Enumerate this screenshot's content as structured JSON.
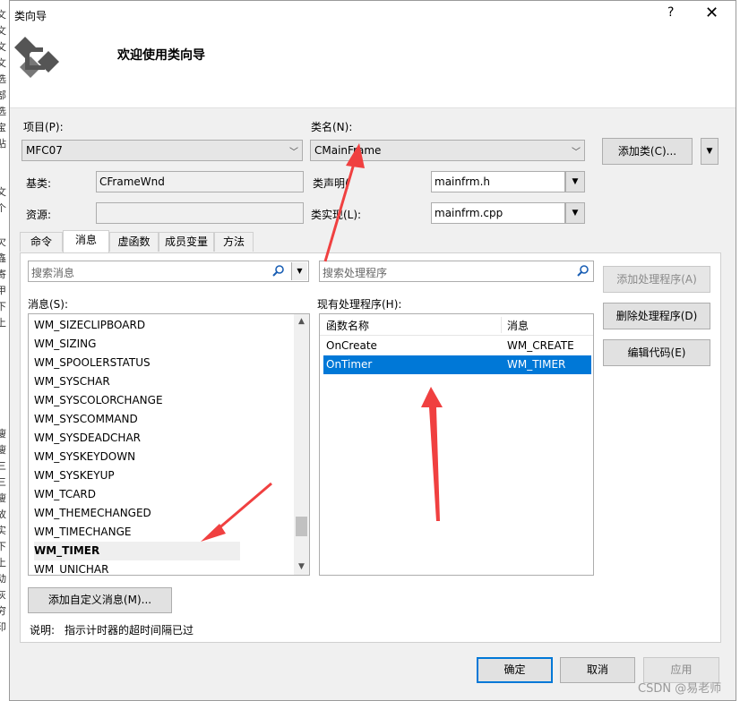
{
  "window": {
    "title": "类向导",
    "help_glyph": "?",
    "close_glyph": "✕"
  },
  "header": {
    "welcome": "欢迎使用类向导"
  },
  "fields": {
    "project_label": "项目(P):",
    "project_value": "MFC07",
    "classname_label": "类名(N):",
    "classname_value": "CMainFrame",
    "baseclass_label": "基类:",
    "baseclass_value": "CFrameWnd",
    "resource_label": "资源:",
    "resource_value": "",
    "decl_label": "类声明(",
    "decl_value": "mainfrm.h",
    "impl_label": "类实现(L):",
    "impl_value": "mainfrm.cpp"
  },
  "buttons": {
    "add_class": "添加类(C)...",
    "add_handler": "添加处理程序(A)",
    "delete_handler": "删除处理程序(D)",
    "edit_code": "编辑代码(E)",
    "add_custom_message": "添加自定义消息(M)...",
    "ok": "确定",
    "cancel": "取消",
    "apply": "应用"
  },
  "tabs": [
    "命令",
    "消息",
    "虚函数",
    "成员变量",
    "方法"
  ],
  "message_search_placeholder": "搜索消息",
  "handler_search_placeholder": "搜索处理程序",
  "messages_label": "消息(S):",
  "handlers_label": "现有处理程序(H):",
  "messages": [
    "WM_SIZECLIPBOARD",
    "WM_SIZING",
    "WM_SPOOLERSTATUS",
    "WM_SYSCHAR",
    "WM_SYSCOLORCHANGE",
    "WM_SYSCOMMAND",
    "WM_SYSDEADCHAR",
    "WM_SYSKEYDOWN",
    "WM_SYSKEYUP",
    "WM_TCARD",
    "WM_THEMECHANGED",
    "WM_TIMECHANGE",
    "WM_TIMER",
    "WM_UNICHAR"
  ],
  "selected_message": "WM_TIMER",
  "handler_columns": [
    "函数名称",
    "消息"
  ],
  "handlers": [
    {
      "func": "OnCreate",
      "msg": "WM_CREATE"
    },
    {
      "func": "OnTimer",
      "msg": "WM_TIMER"
    }
  ],
  "description": {
    "label": "说明:",
    "text": "指示计时器的超时间隔已过"
  },
  "watermark": "CSDN @易老师",
  "background_glyphs": [
    "文",
    "文",
    "文",
    "文",
    "选",
    "部",
    "选",
    "宝",
    "贴",
    "文",
    "个",
    "欠",
    "鑫",
    "寄",
    "甲",
    "下",
    "上",
    "瘦",
    "瘦",
    "三",
    "三",
    "瘦",
    "故",
    "实",
    "下",
    "上",
    "动",
    "灰",
    "穷",
    "印"
  ],
  "colors": {
    "selection": "#0078d7",
    "annotation_arrow": "#f04040"
  }
}
